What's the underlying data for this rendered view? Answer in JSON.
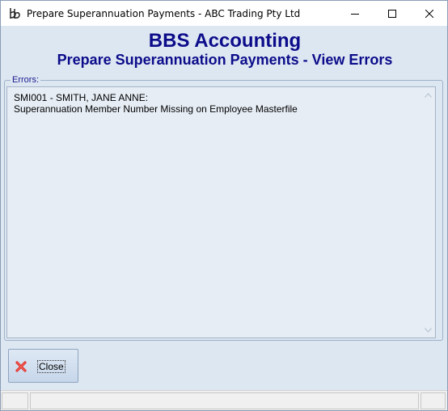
{
  "window": {
    "title": "Prepare Superannuation Payments - ABC Trading Pty Ltd",
    "icon": "bbs-app-icon",
    "controls": [
      "minimize-icon",
      "maximize-icon",
      "close-icon"
    ]
  },
  "header": {
    "title": "BBS Accounting",
    "subtitle": "Prepare Superannuation Payments - View Errors",
    "color": "#0c0c8a"
  },
  "errors": {
    "legend": "Errors:",
    "text": "SMI001 - SMITH, JANE ANNE:\nSuperannuation Member Number Missing on Employee Masterfile"
  },
  "buttons": {
    "close_label": "Close",
    "close_icon": "red-x-icon"
  },
  "colors": {
    "background": "#dde7f2",
    "accent": "#0c0c8a",
    "close_icon": "#e0302a"
  }
}
